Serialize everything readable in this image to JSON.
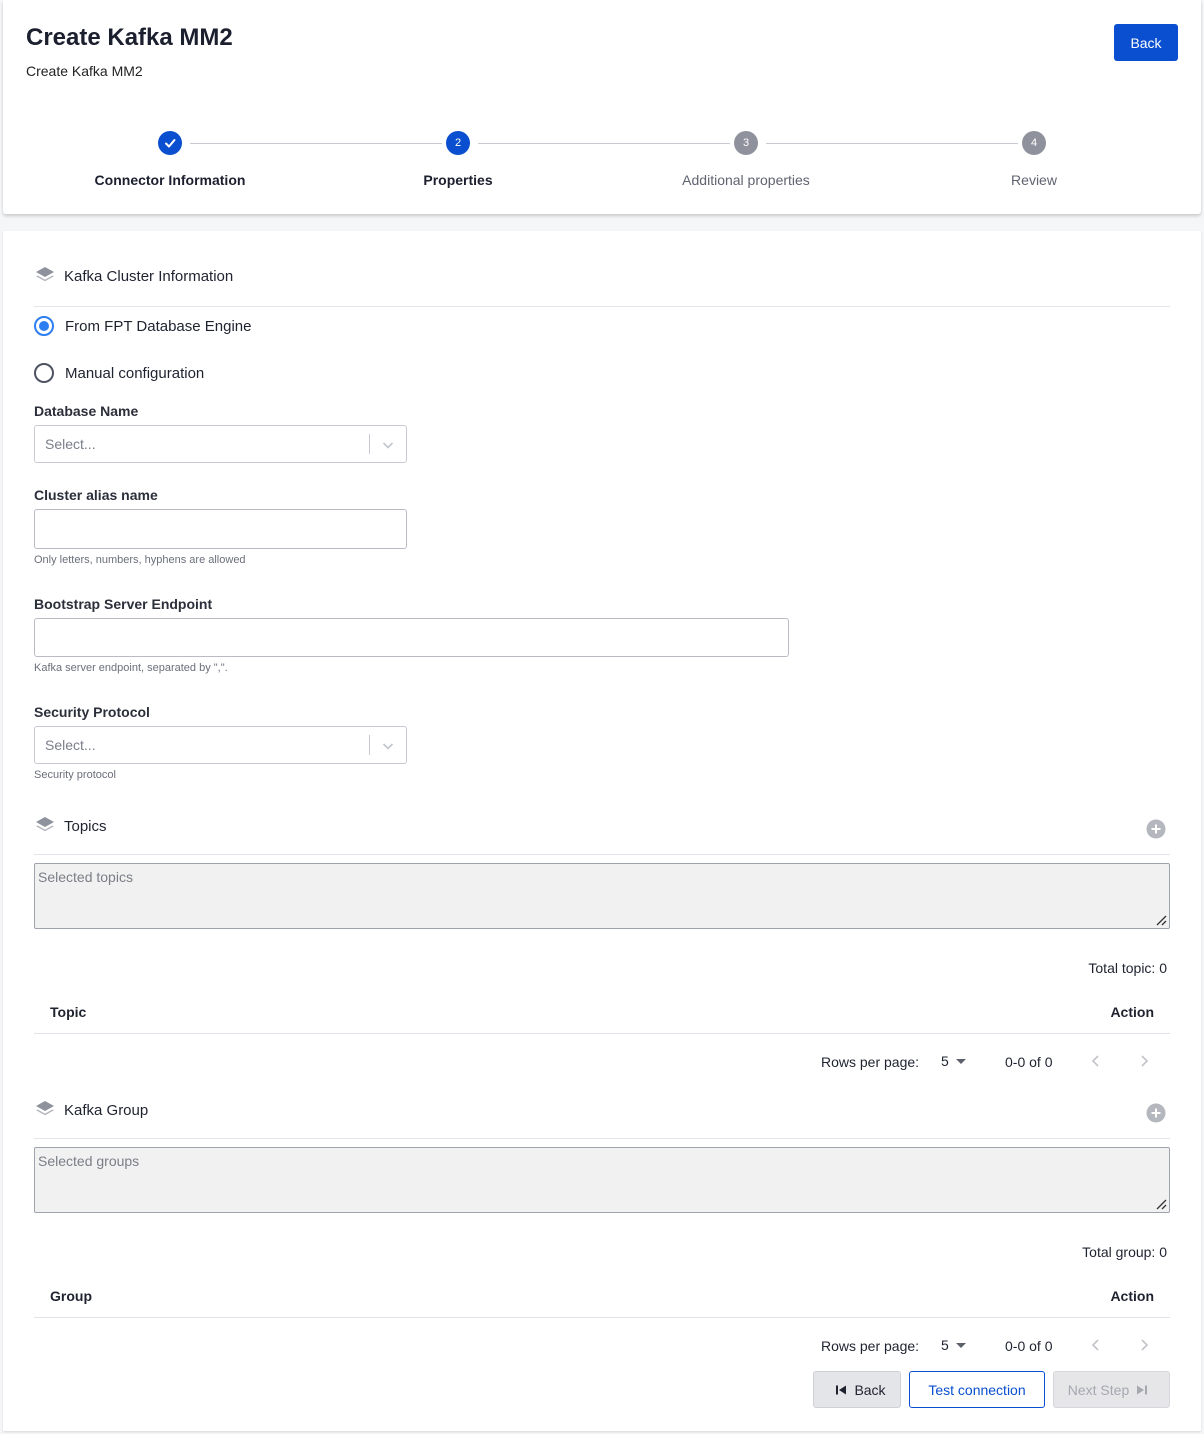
{
  "header": {
    "title": "Create Kafka MM2",
    "subtitle": "Create Kafka MM2",
    "back_label": "Back"
  },
  "stepper": {
    "steps": [
      {
        "number": "1",
        "label": "Connector Information",
        "status": "completed"
      },
      {
        "number": "2",
        "label": "Properties",
        "status": "active"
      },
      {
        "number": "3",
        "label": "Additional properties",
        "status": "pending"
      },
      {
        "number": "4",
        "label": "Review",
        "status": "pending"
      }
    ]
  },
  "cluster_info": {
    "title": "Kafka Cluster Information",
    "icon": "layers-icon",
    "source_options": [
      {
        "label": "From FPT Database Engine",
        "selected": true
      },
      {
        "label": "Manual configuration",
        "selected": false
      }
    ],
    "database_name": {
      "label": "Database Name",
      "placeholder": "Select..."
    },
    "cluster_alias": {
      "label": "Cluster alias name",
      "value": "",
      "helper": "Only letters, numbers, hyphens are allowed"
    },
    "bootstrap": {
      "label": "Bootstrap Server Endpoint",
      "value": "",
      "helper": "Kafka server endpoint, separated by \",\"."
    },
    "security_protocol": {
      "label": "Security Protocol",
      "placeholder": "Select...",
      "helper": "Security protocol"
    }
  },
  "topics": {
    "title": "Topics",
    "textarea_placeholder": "Selected topics",
    "total": "Total topic: 0",
    "columns": [
      "Topic",
      "Action"
    ],
    "rows": [],
    "pagination": {
      "rows_per_page_label": "Rows per page:",
      "rows_per_page": "5",
      "range": "0-0 of 0"
    }
  },
  "groups": {
    "title": "Kafka Group",
    "textarea_placeholder": "Selected groups",
    "total": "Total group: 0",
    "columns": [
      "Group",
      "Action"
    ],
    "rows": [],
    "pagination": {
      "rows_per_page_label": "Rows per page:",
      "rows_per_page": "5",
      "range": "0-0 of 0"
    }
  },
  "footer": {
    "back_label": "Back",
    "test_label": "Test connection",
    "next_label": "Next Step",
    "next_disabled": true
  },
  "colors": {
    "primary": "#0a4fcf",
    "radio_accent": "#2d7ef0",
    "pending_step": "#8f929c"
  }
}
